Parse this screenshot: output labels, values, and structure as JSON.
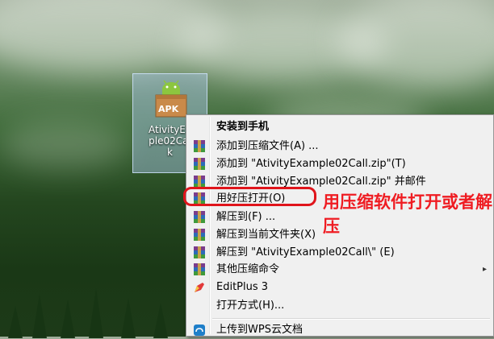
{
  "desktop_icon": {
    "label": "AtivityEx\nple02Cal\nk",
    "badge": "APK"
  },
  "context_menu": {
    "items": [
      {
        "label": "安装到手机",
        "icon": "none",
        "bold": true
      },
      {
        "label": "添加到压缩文件(A) ...",
        "icon": "winrar-icon"
      },
      {
        "label": "添加到 \"AtivityExample02Call.zip\"(T)",
        "icon": "winrar-icon"
      },
      {
        "label": "添加到 \"AtivityExample02Call.zip\" 并邮件",
        "icon": "winrar-icon"
      },
      {
        "label": "用好压打开(O)",
        "icon": "winrar-icon"
      },
      {
        "label": "解压到(F) ...",
        "icon": "winrar-icon"
      },
      {
        "label": "解压到当前文件夹(X)",
        "icon": "winrar-icon"
      },
      {
        "label": "解压到 \"AtivityExample02Call\\\" (E)",
        "icon": "winrar-icon"
      },
      {
        "label": "其他压缩命令",
        "icon": "winrar-icon",
        "submenu": true
      },
      {
        "label": "EditPlus 3",
        "icon": "editplus-icon"
      },
      {
        "label": "打开方式(H)...",
        "icon": "none"
      },
      {
        "label": "上传到WPS云文档",
        "icon": "wps-cloud-icon"
      }
    ],
    "submenu_arrow": "▸"
  },
  "annotation": {
    "text": "用压缩软件打开或者解压",
    "color": "#ef1c22"
  }
}
